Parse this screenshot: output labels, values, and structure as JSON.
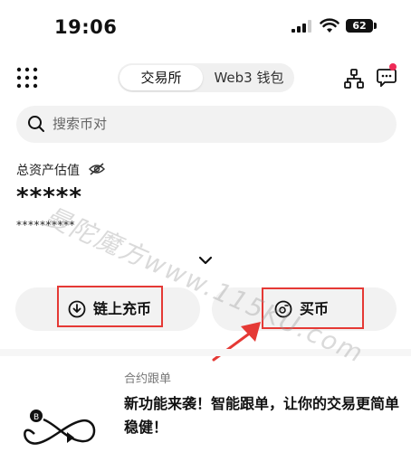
{
  "status_bar": {
    "time": "19:06",
    "battery": "62"
  },
  "header": {
    "tabs": [
      {
        "label": "交易所",
        "active": true
      },
      {
        "label": "Web3 钱包",
        "active": false
      }
    ]
  },
  "search": {
    "placeholder": "搜索币对"
  },
  "assets": {
    "label": "总资产估值",
    "value": "*****",
    "sub_value": "**********"
  },
  "actions": {
    "deposit_label": "链上充币",
    "buy_label": "买币"
  },
  "promo": {
    "tag": "合约跟单",
    "text": "新功能来袭！智能跟单，让你的交易更简单稳健！"
  },
  "watermark": {
    "text": "曼陀魔方www.115KU.com"
  },
  "colors": {
    "highlight": "#e53935",
    "badge": "#ee2a57"
  }
}
